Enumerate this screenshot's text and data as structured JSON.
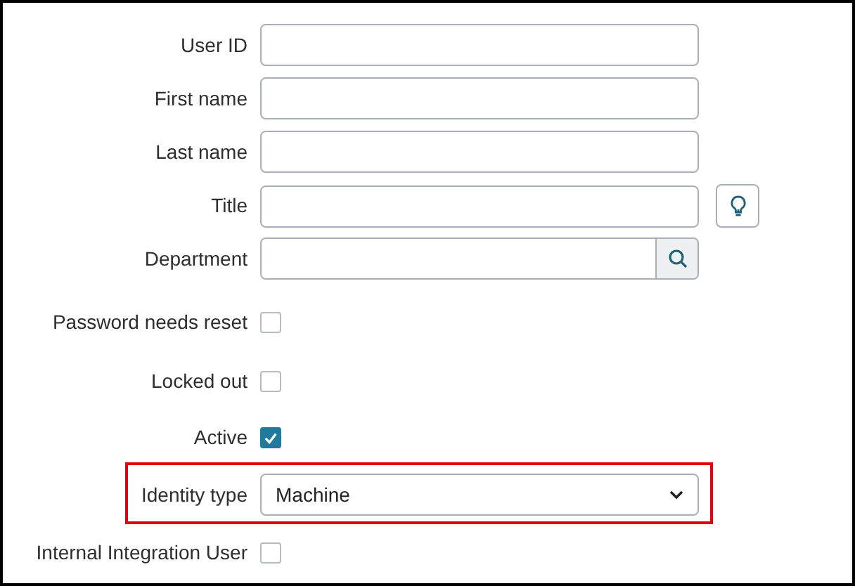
{
  "fields": [
    {
      "kind": "text",
      "label": "User ID"
    },
    {
      "kind": "text",
      "label": "First name"
    },
    {
      "kind": "text",
      "label": "Last name"
    },
    {
      "kind": "text_hint",
      "label": "Title"
    },
    {
      "kind": "lookup",
      "label": "Department"
    },
    {
      "kind": "checkbox",
      "label": "Password needs reset",
      "checked": false
    },
    {
      "kind": "checkbox",
      "label": "Locked out",
      "checked": false
    },
    {
      "kind": "checkbox",
      "label": "Active",
      "checked": true
    },
    {
      "kind": "select",
      "label": "Identity type",
      "value": "Machine",
      "highlighted": true
    },
    {
      "kind": "checkbox",
      "label": "Internal Integration User",
      "checked": false
    }
  ]
}
